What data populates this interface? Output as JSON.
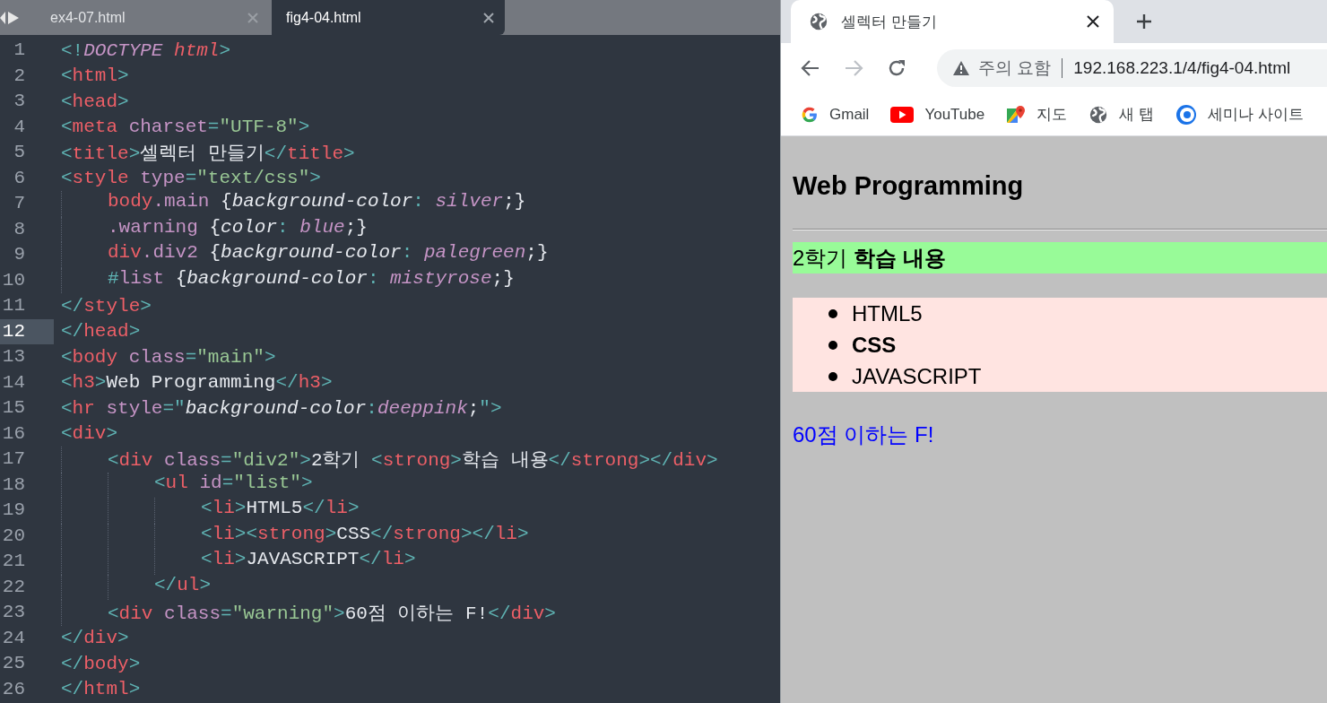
{
  "editor": {
    "tabs": [
      {
        "label": "ex4-07.html",
        "selected": false
      },
      {
        "label": "fig4-04.html",
        "selected": true
      }
    ],
    "lines": [
      {
        "number": "1",
        "current": false,
        "tokens": [
          {
            "kind": "punct",
            "text": "<!"
          },
          {
            "kind": "keyword",
            "text": "DOCTYPE"
          },
          {
            "kind": "itag",
            "text": " html"
          },
          {
            "kind": "punct",
            "text": ">"
          }
        ]
      },
      {
        "number": "2",
        "current": false,
        "tokens": [
          {
            "kind": "punct",
            "text": "<"
          },
          {
            "kind": "tag",
            "text": "html"
          },
          {
            "kind": "punct",
            "text": ">"
          }
        ]
      },
      {
        "number": "3",
        "current": false,
        "tokens": [
          {
            "kind": "punct",
            "text": "<"
          },
          {
            "kind": "tag",
            "text": "head"
          },
          {
            "kind": "punct",
            "text": ">"
          }
        ]
      },
      {
        "number": "4",
        "current": false,
        "tokens": [
          {
            "kind": "punct",
            "text": "<"
          },
          {
            "kind": "tag",
            "text": "meta"
          },
          {
            "kind": "attr",
            "text": " charset"
          },
          {
            "kind": "punct",
            "text": "="
          },
          {
            "kind": "string",
            "text": "\"UTF-8\""
          },
          {
            "kind": "punct",
            "text": ">"
          }
        ]
      },
      {
        "number": "5",
        "current": false,
        "tokens": [
          {
            "kind": "punct",
            "text": "<"
          },
          {
            "kind": "tag",
            "text": "title"
          },
          {
            "kind": "punct",
            "text": ">"
          },
          {
            "kind": "text",
            "text": "셀렉터 만들기"
          },
          {
            "kind": "punct",
            "text": "</"
          },
          {
            "kind": "tag",
            "text": "title"
          },
          {
            "kind": "punct",
            "text": ">"
          }
        ]
      },
      {
        "number": "6",
        "current": false,
        "tokens": [
          {
            "kind": "punct",
            "text": "<"
          },
          {
            "kind": "tag",
            "text": "style"
          },
          {
            "kind": "attr",
            "text": " type"
          },
          {
            "kind": "punct",
            "text": "="
          },
          {
            "kind": "string",
            "text": "\"text/css\""
          },
          {
            "kind": "punct",
            "text": ">"
          }
        ],
        "children": [
          {
            "number": "7",
            "current": false,
            "tokens": [
              {
                "kind": "tag",
                "text": "body"
              },
              {
                "kind": "attr",
                "text": ".main"
              },
              {
                "kind": "text",
                "text": " {"
              },
              {
                "kind": "prop",
                "text": "background-color"
              },
              {
                "kind": "punct",
                "text": ":"
              },
              {
                "kind": "value",
                "text": " silver"
              },
              {
                "kind": "text",
                "text": ";}"
              }
            ]
          },
          {
            "number": "8",
            "current": false,
            "tokens": [
              {
                "kind": "attr",
                "text": ".warning"
              },
              {
                "kind": "text",
                "text": " {"
              },
              {
                "kind": "prop",
                "text": "color"
              },
              {
                "kind": "punct",
                "text": ":"
              },
              {
                "kind": "value",
                "text": " blue"
              },
              {
                "kind": "text",
                "text": ";}"
              }
            ]
          },
          {
            "number": "9",
            "current": false,
            "tokens": [
              {
                "kind": "tag",
                "text": "div"
              },
              {
                "kind": "attr",
                "text": ".div2"
              },
              {
                "kind": "text",
                "text": " {"
              },
              {
                "kind": "prop",
                "text": "background-color"
              },
              {
                "kind": "punct",
                "text": ":"
              },
              {
                "kind": "value",
                "text": " palegreen"
              },
              {
                "kind": "text",
                "text": ";}"
              }
            ]
          },
          {
            "number": "10",
            "current": false,
            "tokens": [
              {
                "kind": "punct",
                "text": "#"
              },
              {
                "kind": "attr",
                "text": "list"
              },
              {
                "kind": "text",
                "text": " {"
              },
              {
                "kind": "prop",
                "text": "background-color"
              },
              {
                "kind": "punct",
                "text": ":"
              },
              {
                "kind": "value",
                "text": " mistyrose"
              },
              {
                "kind": "text",
                "text": ";}"
              }
            ]
          }
        ]
      },
      {
        "number": "11",
        "current": false,
        "tokens": [
          {
            "kind": "punct",
            "text": "</"
          },
          {
            "kind": "tag",
            "text": "style"
          },
          {
            "kind": "punct",
            "text": ">"
          }
        ]
      },
      {
        "number": "12",
        "current": true,
        "tokens": [
          {
            "kind": "punct",
            "text": "</"
          },
          {
            "kind": "tag",
            "text": "head"
          },
          {
            "kind": "punct",
            "text": ">"
          }
        ]
      },
      {
        "number": "13",
        "current": false,
        "tokens": [
          {
            "kind": "punct",
            "text": "<"
          },
          {
            "kind": "tag",
            "text": "body"
          },
          {
            "kind": "attr",
            "text": " class"
          },
          {
            "kind": "punct",
            "text": "="
          },
          {
            "kind": "string",
            "text": "\"main\""
          },
          {
            "kind": "punct",
            "text": ">"
          }
        ]
      },
      {
        "number": "14",
        "current": false,
        "tokens": [
          {
            "kind": "punct",
            "text": "<"
          },
          {
            "kind": "tag",
            "text": "h3"
          },
          {
            "kind": "punct",
            "text": ">"
          },
          {
            "kind": "text",
            "text": "Web Programming"
          },
          {
            "kind": "punct",
            "text": "</"
          },
          {
            "kind": "tag",
            "text": "h3"
          },
          {
            "kind": "punct",
            "text": ">"
          }
        ]
      },
      {
        "number": "15",
        "current": false,
        "tokens": [
          {
            "kind": "punct",
            "text": "<"
          },
          {
            "kind": "tag",
            "text": "hr"
          },
          {
            "kind": "attr",
            "text": " style"
          },
          {
            "kind": "punct",
            "text": "=\""
          },
          {
            "kind": "prop",
            "text": "background-color"
          },
          {
            "kind": "punct",
            "text": ":"
          },
          {
            "kind": "value",
            "text": "deeppink"
          },
          {
            "kind": "text",
            "text": ";"
          },
          {
            "kind": "punct",
            "text": "\">"
          }
        ]
      },
      {
        "number": "16",
        "current": false,
        "tokens": [
          {
            "kind": "punct",
            "text": "<"
          },
          {
            "kind": "tag",
            "text": "div"
          },
          {
            "kind": "punct",
            "text": ">"
          }
        ],
        "children": [
          {
            "number": "17",
            "current": false,
            "tokens": [
              {
                "kind": "punct",
                "text": "<"
              },
              {
                "kind": "tag",
                "text": "div"
              },
              {
                "kind": "attr",
                "text": " class"
              },
              {
                "kind": "punct",
                "text": "="
              },
              {
                "kind": "string",
                "text": "\"div2\""
              },
              {
                "kind": "punct",
                "text": ">"
              },
              {
                "kind": "text",
                "text": "2학기 "
              },
              {
                "kind": "punct",
                "text": "<"
              },
              {
                "kind": "tag",
                "text": "strong"
              },
              {
                "kind": "punct",
                "text": ">"
              },
              {
                "kind": "text",
                "text": "학습 내용"
              },
              {
                "kind": "punct",
                "text": "</"
              },
              {
                "kind": "tag",
                "text": "strong"
              },
              {
                "kind": "punct",
                "text": "></"
              },
              {
                "kind": "tag",
                "text": "div"
              },
              {
                "kind": "punct",
                "text": ">"
              }
            ],
            "children": [
              {
                "number": "18",
                "current": false,
                "tokens": [
                  {
                    "kind": "punct",
                    "text": "<"
                  },
                  {
                    "kind": "tag",
                    "text": "ul"
                  },
                  {
                    "kind": "attr",
                    "text": " id"
                  },
                  {
                    "kind": "punct",
                    "text": "="
                  },
                  {
                    "kind": "string",
                    "text": "\"list\""
                  },
                  {
                    "kind": "punct",
                    "text": ">"
                  }
                ],
                "children": [
                  {
                    "number": "19",
                    "current": false,
                    "tokens": [
                      {
                        "kind": "punct",
                        "text": "<"
                      },
                      {
                        "kind": "tag",
                        "text": "li"
                      },
                      {
                        "kind": "punct",
                        "text": ">"
                      },
                      {
                        "kind": "text",
                        "text": "HTML5"
                      },
                      {
                        "kind": "punct",
                        "text": "</"
                      },
                      {
                        "kind": "tag",
                        "text": "li"
                      },
                      {
                        "kind": "punct",
                        "text": ">"
                      }
                    ]
                  },
                  {
                    "number": "20",
                    "current": false,
                    "tokens": [
                      {
                        "kind": "punct",
                        "text": "<"
                      },
                      {
                        "kind": "tag",
                        "text": "li"
                      },
                      {
                        "kind": "punct",
                        "text": "><"
                      },
                      {
                        "kind": "tag",
                        "text": "strong"
                      },
                      {
                        "kind": "punct",
                        "text": ">"
                      },
                      {
                        "kind": "text",
                        "text": "CSS"
                      },
                      {
                        "kind": "punct",
                        "text": "</"
                      },
                      {
                        "kind": "tag",
                        "text": "strong"
                      },
                      {
                        "kind": "punct",
                        "text": "></"
                      },
                      {
                        "kind": "tag",
                        "text": "li"
                      },
                      {
                        "kind": "punct",
                        "text": ">"
                      }
                    ]
                  },
                  {
                    "number": "21",
                    "current": false,
                    "tokens": [
                      {
                        "kind": "punct",
                        "text": "<"
                      },
                      {
                        "kind": "tag",
                        "text": "li"
                      },
                      {
                        "kind": "punct",
                        "text": ">"
                      },
                      {
                        "kind": "text",
                        "text": "JAVASCRIPT"
                      },
                      {
                        "kind": "punct",
                        "text": "</"
                      },
                      {
                        "kind": "tag",
                        "text": "li"
                      },
                      {
                        "kind": "punct",
                        "text": ">"
                      }
                    ]
                  }
                ]
              },
              {
                "number": "22",
                "current": false,
                "tokens": [
                  {
                    "kind": "punct",
                    "text": "</"
                  },
                  {
                    "kind": "tag",
                    "text": "ul"
                  },
                  {
                    "kind": "punct",
                    "text": ">"
                  }
                ]
              }
            ]
          },
          {
            "number": "23",
            "current": false,
            "tokens": [
              {
                "kind": "punct",
                "text": "<"
              },
              {
                "kind": "tag",
                "text": "div"
              },
              {
                "kind": "attr",
                "text": " class"
              },
              {
                "kind": "punct",
                "text": "="
              },
              {
                "kind": "string",
                "text": "\"warning\""
              },
              {
                "kind": "punct",
                "text": ">"
              },
              {
                "kind": "text",
                "text": "60점 이하는 F!"
              },
              {
                "kind": "punct",
                "text": "</"
              },
              {
                "kind": "tag",
                "text": "div"
              },
              {
                "kind": "punct",
                "text": ">"
              }
            ]
          }
        ]
      },
      {
        "number": "24",
        "current": false,
        "tokens": [
          {
            "kind": "punct",
            "text": "</"
          },
          {
            "kind": "tag",
            "text": "div"
          },
          {
            "kind": "punct",
            "text": ">"
          }
        ]
      },
      {
        "number": "25",
        "current": false,
        "tokens": [
          {
            "kind": "punct",
            "text": "</"
          },
          {
            "kind": "tag",
            "text": "body"
          },
          {
            "kind": "punct",
            "text": ">"
          }
        ]
      },
      {
        "number": "26",
        "current": false,
        "tokens": [
          {
            "kind": "punct",
            "text": "</"
          },
          {
            "kind": "tag",
            "text": "html"
          },
          {
            "kind": "punct",
            "text": ">"
          }
        ]
      }
    ]
  },
  "browser": {
    "tab": {
      "title": "셀렉터 만들기",
      "selected": true
    },
    "toolbar": {
      "forward_disabled": true,
      "security": "주의 요함",
      "url": "192.168.223.1/4/fig4-04.html"
    },
    "bookmarks": [
      {
        "kind": "google",
        "label": "Gmail"
      },
      {
        "kind": "youtube",
        "label": "YouTube"
      },
      {
        "kind": "maps",
        "label": "지도"
      },
      {
        "kind": "globe",
        "label": "새 탭"
      },
      {
        "kind": "target",
        "label": "세미나 사이트"
      }
    ],
    "page": {
      "heading": "Web Programming",
      "highlight": "2학기 **학습 내용**",
      "list": [
        {
          "text": "HTML5",
          "bold": false
        },
        {
          "text": "CSS",
          "bold": true
        },
        {
          "text": "JAVASCRIPT",
          "bold": false
        }
      ],
      "warning": "60점 이하는 F!"
    }
  }
}
